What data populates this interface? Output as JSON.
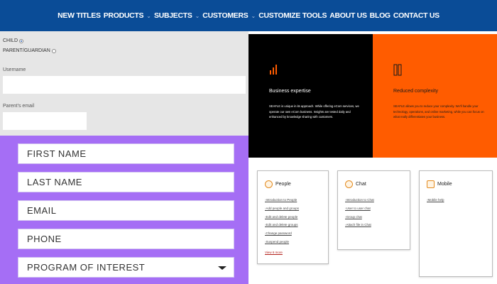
{
  "nav": {
    "items": [
      "NEW TITLES",
      "PRODUCTS",
      "SUBJECTS",
      "CUSTOMERS",
      "CUSTOMIZE TOOLS",
      "ABOUT US",
      "BLOG",
      "CONTACT US"
    ],
    "chevron_after": [
      false,
      true,
      true,
      true,
      false,
      false,
      false,
      false
    ],
    "bg_color": "#0a4c97"
  },
  "gray_form": {
    "radio_child": "CHILD",
    "radio_parent": "PARENT/GUARDIAN",
    "username_label": "Username",
    "parent_email_label": "Parent's email"
  },
  "purple_form": {
    "bg_color": "#a56ef5",
    "fields": [
      "FIRST NAME",
      "LAST NAME",
      "EMAIL",
      "PHONE",
      "PROGRAM OF INTEREST"
    ]
  },
  "feature_panels": [
    {
      "title": "Business expertise",
      "body": "SEAFLE is unique in its approach. While offering eCom services, we operate our own eCom business. Insights are tested daily and enhanced by knowledge sharing with customers.",
      "bg_color": "#000000"
    },
    {
      "title": "Reduced complexity",
      "body": "SEAFLE allows you to reduce your complexity. We'll handle your technology, operations, and online marketing, while you can focus on what really differentiates your business.",
      "bg_color": "#ff5c00"
    }
  ],
  "cards": [
    {
      "title": "People",
      "icon": "people-icon",
      "items": [
        "Introduction to People",
        "Add people and groups",
        "Edit and delete people",
        "Edit and delete groups",
        "Change password",
        "Suspend people"
      ],
      "view_more": "View 6 more"
    },
    {
      "title": "Chat",
      "icon": "chat-icon",
      "items": [
        "Introduction to Chat",
        "User to user chat",
        "Group chat",
        "Attach file in Chat"
      ],
      "view_more": ""
    },
    {
      "title": "Mobile",
      "icon": "mobile-icon",
      "items": [
        "Mobile help"
      ],
      "view_more": ""
    }
  ]
}
